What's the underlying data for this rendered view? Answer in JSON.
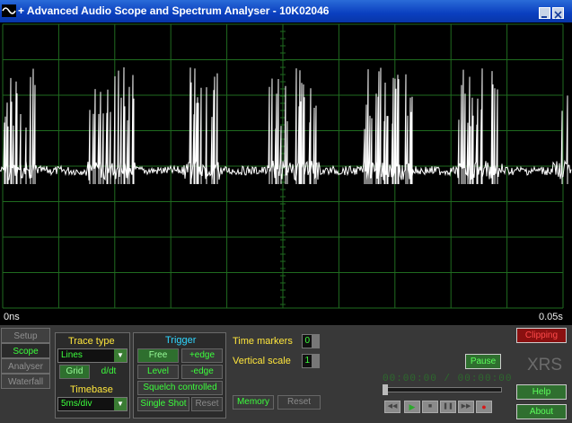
{
  "window": {
    "title": "+ Advanced Audio Scope and Spectrum Analyser - 10K02046",
    "icon": "sine-wave-icon"
  },
  "scope": {
    "time_start": "0ns",
    "time_end": "0.05s",
    "grid_color": "#1f6b1f",
    "trace_color": "#ffffff"
  },
  "tabs": [
    {
      "label": "Setup",
      "active": false
    },
    {
      "label": "Scope",
      "active": true
    },
    {
      "label": "Analyser",
      "active": false
    },
    {
      "label": "Waterfall",
      "active": false
    }
  ],
  "trace_type": {
    "heading": "Trace type",
    "value": "Lines",
    "grid_label": "Grid",
    "ddt_label": "d/dt"
  },
  "timebase": {
    "heading": "Timebase",
    "value": "5ms/div"
  },
  "trigger": {
    "heading": "Trigger",
    "free_label": "Free",
    "pos_edge_label": "+edge",
    "level_label": "Level",
    "neg_edge_label": "-edge",
    "squelch_label": "Squelch controlled",
    "single_shot_label": "Single Shot",
    "reset_label": "Reset"
  },
  "markers": {
    "time_markers_label": "Time markers",
    "time_markers_value": "0",
    "vertical_scale_label": "Vertical scale",
    "vertical_scale_value": "1"
  },
  "memory": {
    "memory_label": "Memory",
    "reset_label": "Reset"
  },
  "playback": {
    "pause_label": "Pause",
    "time_display": "00:00:00 / 00:00:00"
  },
  "right": {
    "clipping_label": "Clipping",
    "brand": "XRS",
    "help_label": "Help",
    "about_label": "About"
  },
  "colors": {
    "accent_green": "#3cff3c",
    "heading_yellow": "#ffe63c",
    "trigger_cyan": "#2fd6ff",
    "clip_red": "#8a1010"
  }
}
